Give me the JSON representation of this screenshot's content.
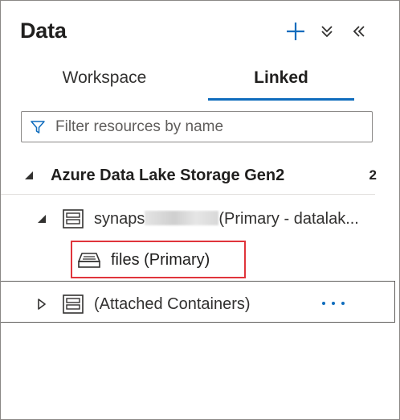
{
  "header": {
    "title": "Data",
    "add_icon": "plus-icon",
    "collapse_icon": "chevron-double-down-icon",
    "hide_icon": "chevron-double-left-icon"
  },
  "tabs": [
    {
      "label": "Workspace",
      "active": false
    },
    {
      "label": "Linked",
      "active": true
    }
  ],
  "filter": {
    "placeholder": "Filter resources by name",
    "value": ""
  },
  "tree": {
    "group": {
      "label": "Azure Data Lake Storage Gen2",
      "count": "2"
    },
    "account": {
      "name_prefix": "synaps",
      "name_suffix": "(Primary - datalak..."
    },
    "container": {
      "label": "files (Primary)"
    },
    "attached": {
      "label": "(Attached Containers)",
      "more": "···"
    }
  },
  "colors": {
    "accent": "#0f6cbd",
    "highlight": "#e0343b"
  }
}
